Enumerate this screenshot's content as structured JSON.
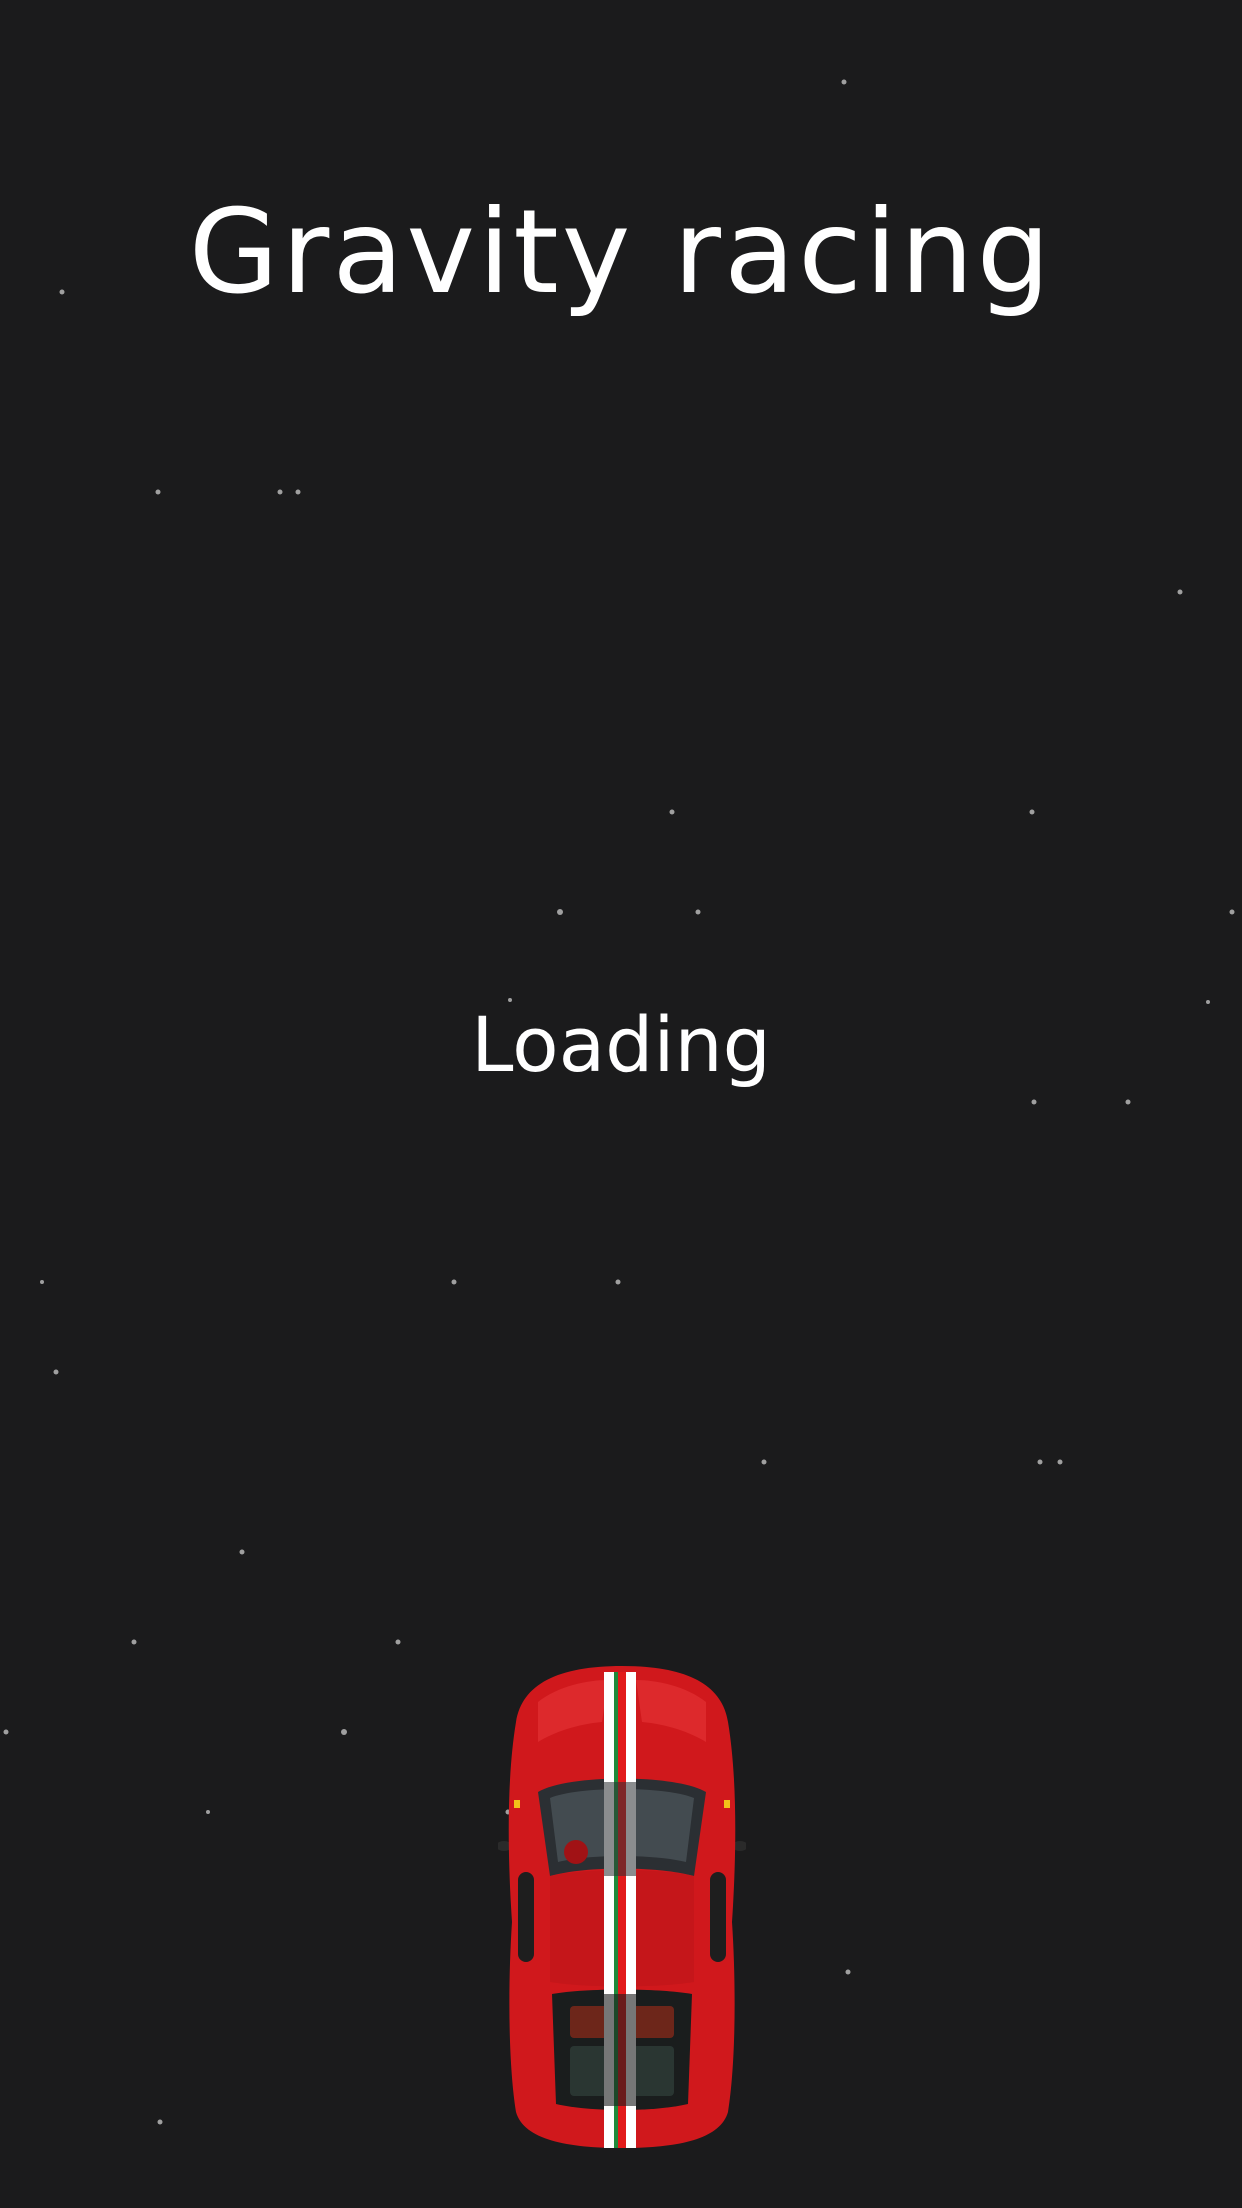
{
  "title": "Gravity racing",
  "status": "Loading",
  "car": {
    "icon": "red-sports-car-top-view-icon",
    "body_color": "#d0181c",
    "stripe_colors": [
      "#ffffff",
      "#1f8a3a",
      "#e21b1b"
    ]
  },
  "colors": {
    "background": "#1b1b1c",
    "text": "#ffffff",
    "stars": "#9a9a9a"
  }
}
